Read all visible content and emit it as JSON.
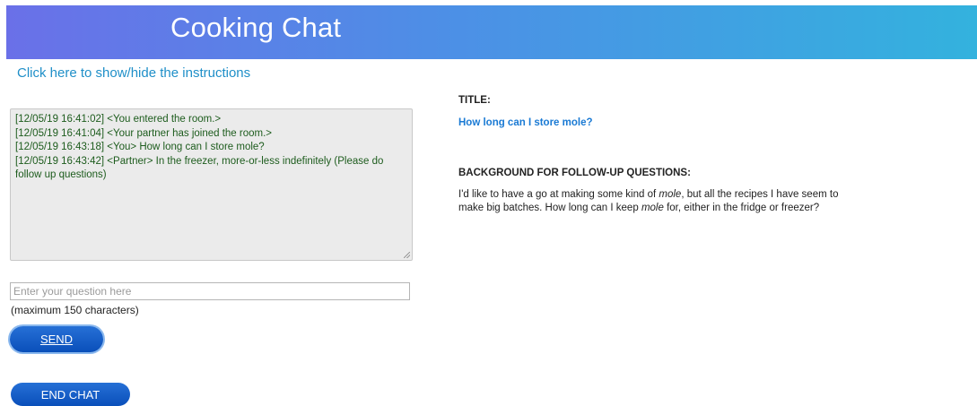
{
  "header": {
    "title": "Cooking Chat"
  },
  "instructions_toggle": {
    "label": "Click here to show/hide the instructions"
  },
  "chat_log": {
    "lines": [
      "[12/05/19 16:41:02] <You entered the room.>",
      "[12/05/19 16:41:04] <Your partner has joined the room.>",
      "[12/05/19 16:43:18] <You> How long can I store mole?",
      "[12/05/19 16:43:42] <Partner> In the freezer, more-or-less indefinitely (Please do follow up questions)"
    ]
  },
  "question_input": {
    "value": "",
    "placeholder": "Enter your question here"
  },
  "char_limit_note": "(maximum 150 characters)",
  "buttons": {
    "send_label": "SEND",
    "end_chat_label": "END CHAT"
  },
  "info_panel": {
    "title_label": "TITLE:",
    "title_value": "How long can I store mole?",
    "background_label": "BACKGROUND FOR FOLLOW-UP QUESTIONS:",
    "background_parts": {
      "p1": "I'd like to have a go at making some kind of ",
      "em1": "mole",
      "p2": ", but all the recipes I have seem to make big batches. How long can I keep ",
      "em2": "mole",
      "p3": " for, either in the fridge or freezer?"
    }
  },
  "colors": {
    "header_gradient_start": "#6a70e8",
    "header_gradient_end": "#33b2de",
    "link": "#1f8fc8",
    "chat_text": "#1d5c1d",
    "button_blue": "#0a4fba",
    "title_value": "#1a7ad4"
  }
}
